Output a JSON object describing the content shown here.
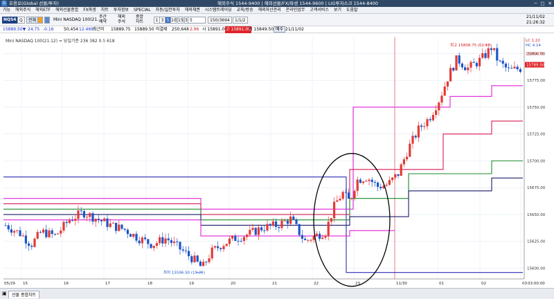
{
  "titlebar": {
    "app_title": "호용로(Global 선물/투자)",
    "info": "해외주식 1544-9400 | 해외선물/FX/파생 1544-9600 | LIG투자스크 1544-8400",
    "min": "─",
    "max": "□",
    "close": "✕"
  },
  "menubar": {
    "items": [
      "가능",
      "해외주식",
      "해외ETF",
      "해외선물종합",
      "FX파생",
      "차트",
      "투자정보",
      "SPECIAL",
      "자동/실전투자",
      "해외채권",
      "시스템트레이딩",
      "교육/방송",
      "해외자산관리",
      "온라인업무",
      "고객서비스",
      "보기",
      "도움말"
    ],
    "right_items": [
      "",
      "",
      "",
      ""
    ]
  },
  "toolbar": {
    "symbol": "NQ54",
    "dropdown": "Q",
    "code_label": "전체",
    "name_label": "Mini NASDAQ 100(21.",
    "btn_a": "주간",
    "btn_a2": "예약",
    "btn_b": "해외",
    "btn_b2": "주석",
    "btn_c": "종합",
    "btn_c2": "차트",
    "periods": [
      "1",
      "3",
      "5",
      "10",
      "15",
      "30",
      "45",
      "60"
    ],
    "interval_value": "5",
    "count_value": "150/3694",
    "date_value": "1/1/2",
    "clock1": "21/11/02",
    "clock2": "21:26:32"
  },
  "quotebar": {
    "price": "15889.50▼",
    "change": "24.75",
    "pct": "-0.16",
    "vol": "50,454",
    "vol_pct": "12.469",
    "open_label": "최근미",
    "open_val": "15889.75",
    "prev_val": "15889.50",
    "ask_label": "미결제",
    "ask_val": "250,648",
    "ask_chg": "2.96",
    "hi": "시 15891.00",
    "hi2": "고 15891.00",
    "lo": "저 15849.50",
    "lo_btn": "매수",
    "date": "21/11/02"
  },
  "chart_data": {
    "type": "candlestick",
    "title": "Mini NASDAQ 100(21.12) = 당일기준 236 382 0.5 618",
    "yticks": [
      "15800.00",
      "15775.00",
      "15750.00",
      "15725.00",
      "15700.00",
      "15675.00",
      "15650.00",
      "15625.00",
      "15600.00"
    ],
    "xticks": [
      "05/29",
      "15",
      "16",
      "17",
      "18",
      "19",
      "20",
      "21",
      "22",
      "23",
      "11/30",
      "01",
      "02",
      "03",
      "03:00:00"
    ],
    "ylim": [
      15590,
      15815
    ],
    "high_label": "최고 15808.75 (02:15)",
    "low_label": "최저 15596.50 (19:25)",
    "last_price_label": "15789.50",
    "right_labels": [
      "LC 1.22",
      "HC 4.14",
      "15794.75"
    ],
    "colors": {
      "up": "#e23a35",
      "down": "#1d55c9",
      "blue_line": "#2a2ab8",
      "magenta_line": "#e020d8",
      "red_line": "#d81a52",
      "green_line": "#1a8a2a",
      "navy_line": "#1a1a6a",
      "circle": "#000000",
      "vline": "#e06060"
    }
  },
  "statusbar": {
    "tab1": "선물 종합차트",
    "tab2": "",
    "icon": "▣"
  }
}
